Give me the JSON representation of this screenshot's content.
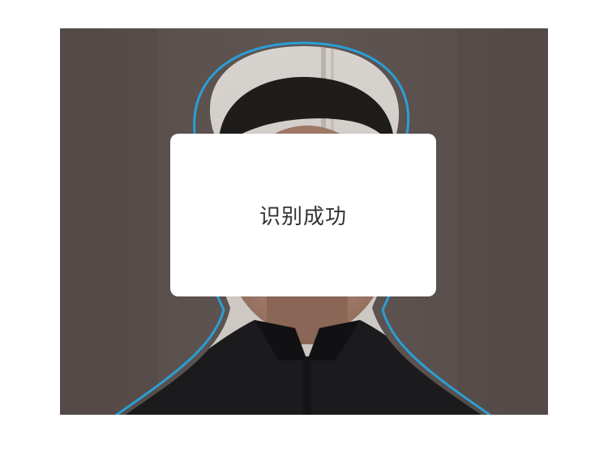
{
  "dialog": {
    "message": "识别成功"
  },
  "colors": {
    "frame_overlay": "#5a504d",
    "outline_accent": "#2a9fd6",
    "dialog_background": "#ffffff",
    "dialog_text": "#333333"
  },
  "icons": {
    "face_outline": "face-outline-guide"
  }
}
